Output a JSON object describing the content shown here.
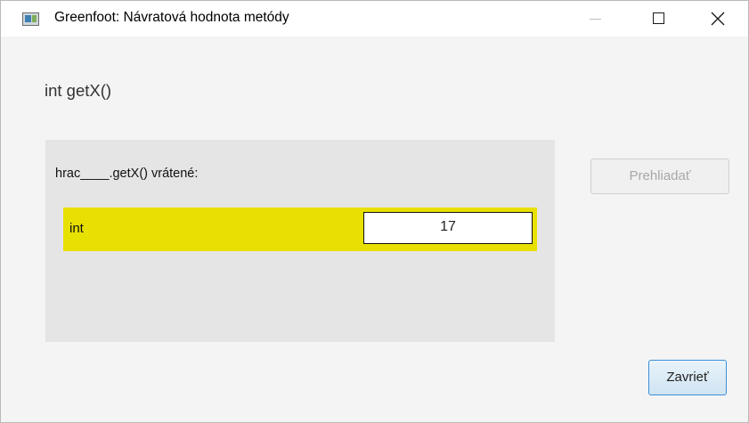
{
  "window": {
    "title": "Greenfoot:  Návratová hodnota metódy",
    "icon": "greenfoot-app-icon"
  },
  "dialog": {
    "method_signature": "int getX()",
    "result_label": "hrac____.getX() vrátené:",
    "result": {
      "type": "int",
      "value": "17",
      "highlight_color": "#e8e000"
    },
    "inspect_label": "Prehliadať",
    "inspect_enabled": false,
    "close_label": "Zavrieť"
  }
}
